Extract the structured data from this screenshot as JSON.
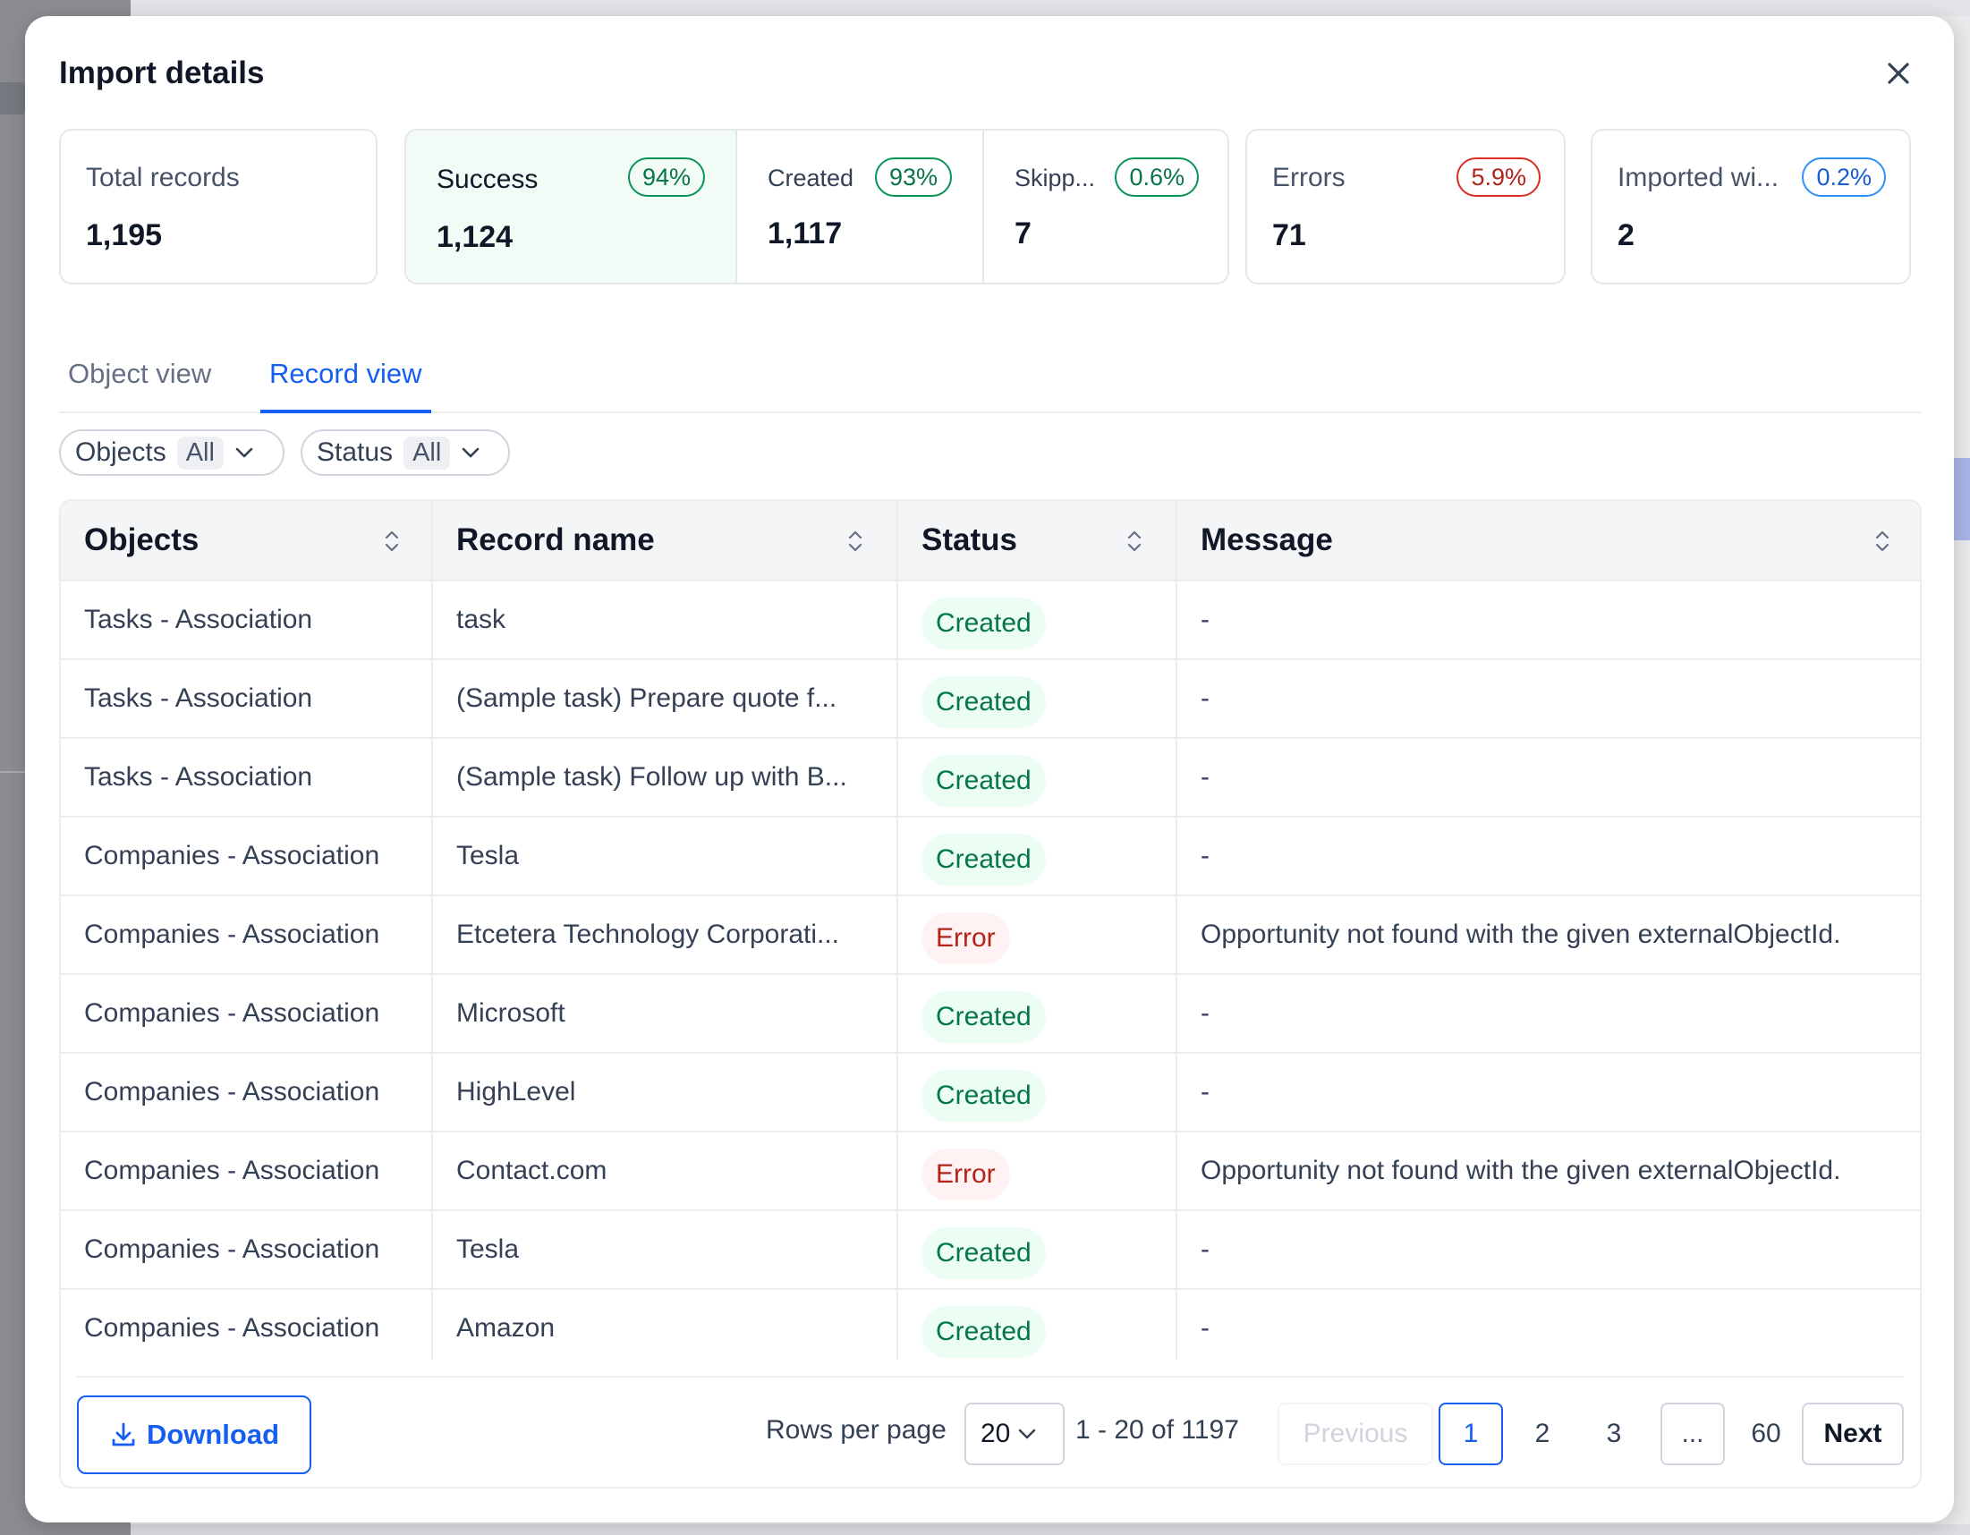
{
  "modal": {
    "title": "Import details"
  },
  "stats": {
    "total": {
      "label": "Total records",
      "value": "1,195"
    },
    "success": {
      "label": "Success",
      "pct": "94%",
      "value": "1,124"
    },
    "created": {
      "label": "Created",
      "pct": "93%",
      "value": "1,117"
    },
    "skipped": {
      "label": "Skipp...",
      "pct": "0.6%",
      "value": "7"
    },
    "errors": {
      "label": "Errors",
      "pct": "5.9%",
      "value": "71"
    },
    "imported": {
      "label": "Imported wi...",
      "pct": "0.2%",
      "value": "2"
    }
  },
  "tabs": {
    "object": "Object view",
    "record": "Record view",
    "active": "record"
  },
  "filters": {
    "objects": {
      "label": "Objects",
      "value": "All"
    },
    "status": {
      "label": "Status",
      "value": "All"
    }
  },
  "table": {
    "headers": [
      "Objects",
      "Record name",
      "Status",
      "Message"
    ],
    "rows": [
      {
        "object": "Tasks - Association",
        "name": "task",
        "status": "Created",
        "message": "-"
      },
      {
        "object": "Tasks - Association",
        "name": "(Sample task) Prepare quote f...",
        "status": "Created",
        "message": "-"
      },
      {
        "object": "Tasks - Association",
        "name": "(Sample task) Follow up with B...",
        "status": "Created",
        "message": "-"
      },
      {
        "object": "Companies - Association",
        "name": "Tesla",
        "status": "Created",
        "message": "-"
      },
      {
        "object": "Companies - Association",
        "name": "Etcetera Technology Corporati...",
        "status": "Error",
        "message": "Opportunity not found with the given externalObjectId."
      },
      {
        "object": "Companies - Association",
        "name": "Microsoft",
        "status": "Created",
        "message": "-"
      },
      {
        "object": "Companies - Association",
        "name": "HighLevel",
        "status": "Created",
        "message": "-"
      },
      {
        "object": "Companies - Association",
        "name": "Contact.com",
        "status": "Error",
        "message": "Opportunity not found with the given externalObjectId."
      },
      {
        "object": "Companies - Association",
        "name": "Tesla",
        "status": "Created",
        "message": "-"
      },
      {
        "object": "Companies - Association",
        "name": "Amazon",
        "status": "Created",
        "message": "-"
      }
    ]
  },
  "footer": {
    "download_label": "Download",
    "rows_per_page_label": "Rows per page",
    "rows_per_page_value": "20",
    "range_text": "1 - 20 of 1197",
    "pagination": {
      "previous": "Previous",
      "pages": [
        "1",
        "2",
        "3",
        "...",
        "60"
      ],
      "current": "1",
      "next": "Next"
    }
  },
  "colors": {
    "accent": "#155eef",
    "success": "#067647",
    "error": "#b42318",
    "info": "#175cd3"
  }
}
